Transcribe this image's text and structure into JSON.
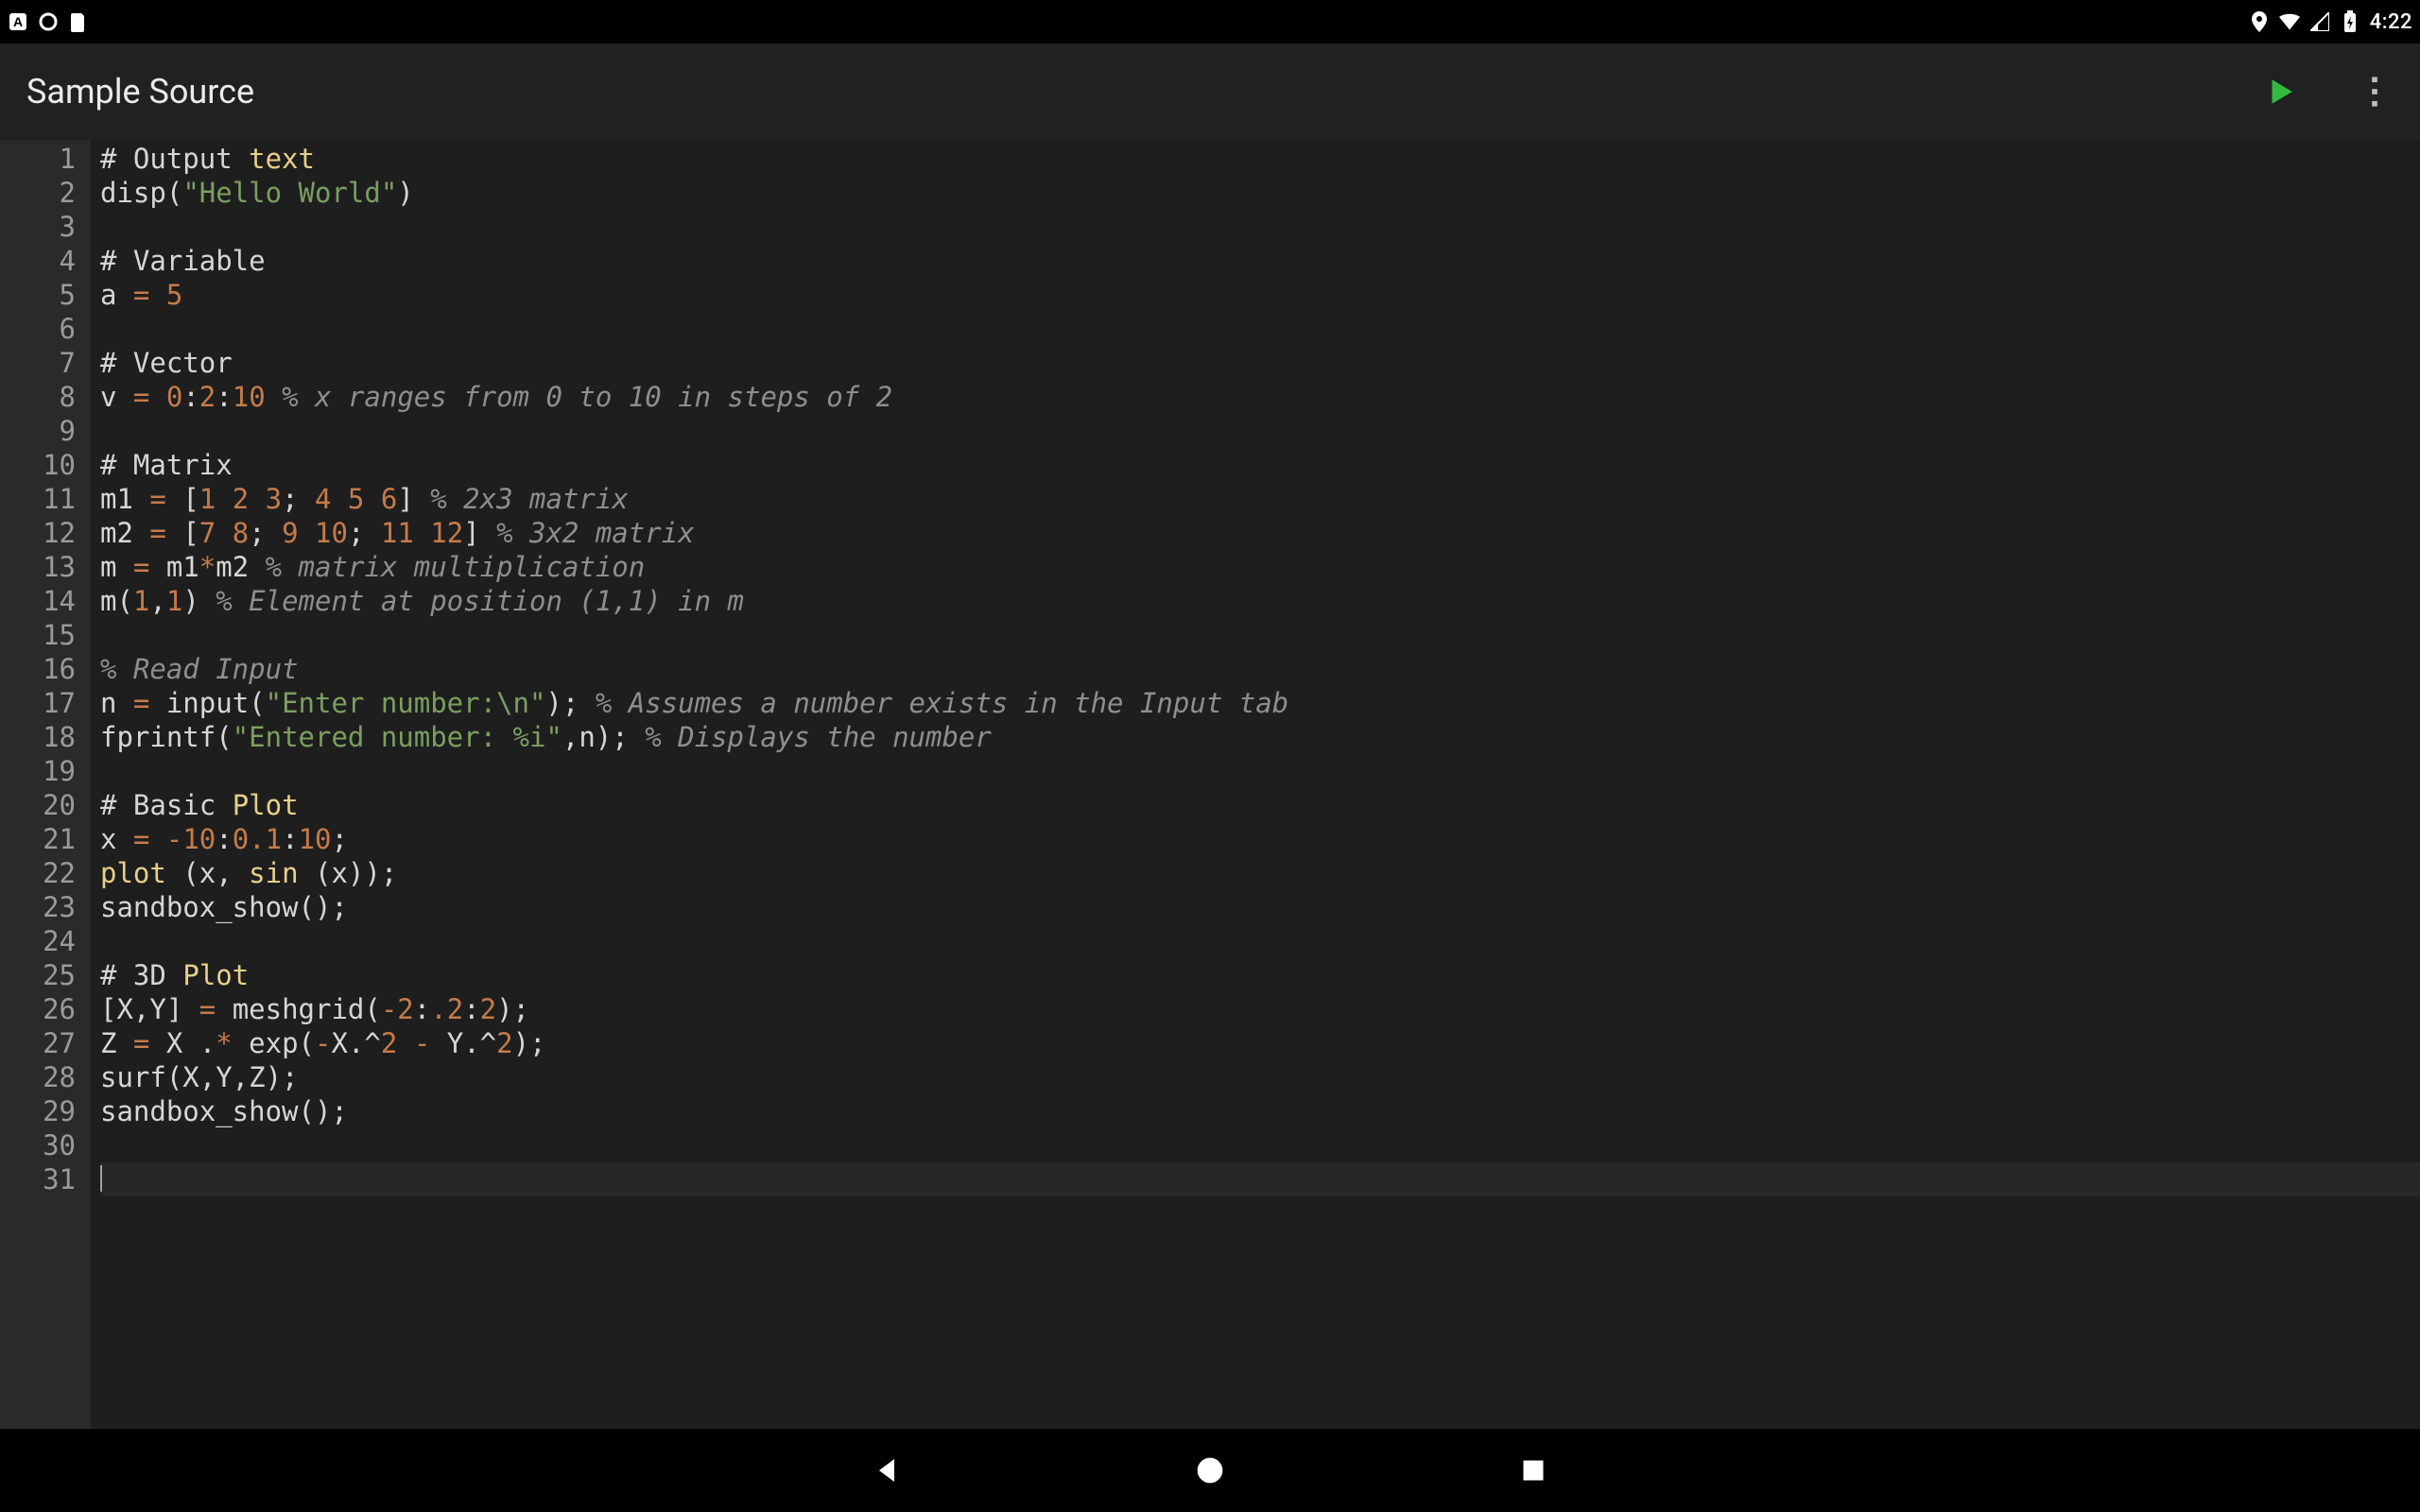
{
  "status": {
    "time": "4:22"
  },
  "appbar": {
    "title": "Sample Source"
  },
  "editor": {
    "current_line": 31,
    "lines": [
      {
        "n": 1,
        "tokens": [
          {
            "c": "tok-plain",
            "t": "# Output "
          },
          {
            "c": "tok-key",
            "t": "text"
          }
        ]
      },
      {
        "n": 2,
        "tokens": [
          {
            "c": "tok-id",
            "t": "disp("
          },
          {
            "c": "tok-str",
            "t": "\"Hello World\""
          },
          {
            "c": "tok-id",
            "t": ")"
          }
        ]
      },
      {
        "n": 3,
        "tokens": []
      },
      {
        "n": 4,
        "tokens": [
          {
            "c": "tok-plain",
            "t": "# Variable"
          }
        ]
      },
      {
        "n": 5,
        "tokens": [
          {
            "c": "tok-id",
            "t": "a "
          },
          {
            "c": "tok-eq",
            "t": "="
          },
          {
            "c": "tok-id",
            "t": " "
          },
          {
            "c": "tok-num",
            "t": "5"
          }
        ]
      },
      {
        "n": 6,
        "tokens": []
      },
      {
        "n": 7,
        "tokens": [
          {
            "c": "tok-plain",
            "t": "# Vector"
          }
        ]
      },
      {
        "n": 8,
        "tokens": [
          {
            "c": "tok-id",
            "t": "v "
          },
          {
            "c": "tok-eq",
            "t": "="
          },
          {
            "c": "tok-id",
            "t": " "
          },
          {
            "c": "tok-num",
            "t": "0"
          },
          {
            "c": "tok-id",
            "t": ":"
          },
          {
            "c": "tok-num",
            "t": "2"
          },
          {
            "c": "tok-id",
            "t": ":"
          },
          {
            "c": "tok-num",
            "t": "10"
          },
          {
            "c": "tok-id",
            "t": " "
          },
          {
            "c": "tok-cmt",
            "t": "% x ranges from 0 to 10 in steps of 2"
          }
        ]
      },
      {
        "n": 9,
        "tokens": []
      },
      {
        "n": 10,
        "tokens": [
          {
            "c": "tok-plain",
            "t": "# Matrix"
          }
        ]
      },
      {
        "n": 11,
        "tokens": [
          {
            "c": "tok-id",
            "t": "m1 "
          },
          {
            "c": "tok-eq",
            "t": "="
          },
          {
            "c": "tok-id",
            "t": " ["
          },
          {
            "c": "tok-num",
            "t": "1 2 3"
          },
          {
            "c": "tok-id",
            "t": "; "
          },
          {
            "c": "tok-num",
            "t": "4 5 6"
          },
          {
            "c": "tok-id",
            "t": "] "
          },
          {
            "c": "tok-cmt",
            "t": "% 2x3 matrix"
          }
        ]
      },
      {
        "n": 12,
        "tokens": [
          {
            "c": "tok-id",
            "t": "m2 "
          },
          {
            "c": "tok-eq",
            "t": "="
          },
          {
            "c": "tok-id",
            "t": " ["
          },
          {
            "c": "tok-num",
            "t": "7 8"
          },
          {
            "c": "tok-id",
            "t": "; "
          },
          {
            "c": "tok-num",
            "t": "9 10"
          },
          {
            "c": "tok-id",
            "t": "; "
          },
          {
            "c": "tok-num",
            "t": "11 12"
          },
          {
            "c": "tok-id",
            "t": "] "
          },
          {
            "c": "tok-cmt",
            "t": "% 3x2 matrix"
          }
        ]
      },
      {
        "n": 13,
        "tokens": [
          {
            "c": "tok-id",
            "t": "m "
          },
          {
            "c": "tok-eq",
            "t": "="
          },
          {
            "c": "tok-id",
            "t": " m1"
          },
          {
            "c": "tok-eq",
            "t": "*"
          },
          {
            "c": "tok-id",
            "t": "m2 "
          },
          {
            "c": "tok-cmt",
            "t": "% matrix multiplication"
          }
        ]
      },
      {
        "n": 14,
        "tokens": [
          {
            "c": "tok-id",
            "t": "m("
          },
          {
            "c": "tok-num",
            "t": "1"
          },
          {
            "c": "tok-id",
            "t": ","
          },
          {
            "c": "tok-num",
            "t": "1"
          },
          {
            "c": "tok-id",
            "t": ") "
          },
          {
            "c": "tok-cmt",
            "t": "% Element at position (1,1) in m"
          }
        ]
      },
      {
        "n": 15,
        "tokens": []
      },
      {
        "n": 16,
        "tokens": [
          {
            "c": "tok-cmt",
            "t": "% Read Input"
          }
        ]
      },
      {
        "n": 17,
        "tokens": [
          {
            "c": "tok-id",
            "t": "n "
          },
          {
            "c": "tok-eq",
            "t": "="
          },
          {
            "c": "tok-id",
            "t": " input("
          },
          {
            "c": "tok-str",
            "t": "\"Enter number:\\n\""
          },
          {
            "c": "tok-id",
            "t": "); "
          },
          {
            "c": "tok-cmt",
            "t": "% Assumes a number exists in the Input tab"
          }
        ]
      },
      {
        "n": 18,
        "tokens": [
          {
            "c": "tok-id",
            "t": "fprintf("
          },
          {
            "c": "tok-str",
            "t": "\"Entered number: %i\""
          },
          {
            "c": "tok-id",
            "t": ",n); "
          },
          {
            "c": "tok-cmt",
            "t": "% Displays the number"
          }
        ]
      },
      {
        "n": 19,
        "tokens": []
      },
      {
        "n": 20,
        "tokens": [
          {
            "c": "tok-plain",
            "t": "# Basic "
          },
          {
            "c": "tok-key",
            "t": "Plot"
          }
        ]
      },
      {
        "n": 21,
        "tokens": [
          {
            "c": "tok-id",
            "t": "x "
          },
          {
            "c": "tok-eq",
            "t": "="
          },
          {
            "c": "tok-id",
            "t": " "
          },
          {
            "c": "tok-num",
            "t": "-10"
          },
          {
            "c": "tok-id",
            "t": ":"
          },
          {
            "c": "tok-num",
            "t": "0.1"
          },
          {
            "c": "tok-id",
            "t": ":"
          },
          {
            "c": "tok-num",
            "t": "10"
          },
          {
            "c": "tok-id",
            "t": ";"
          }
        ]
      },
      {
        "n": 22,
        "tokens": [
          {
            "c": "tok-key",
            "t": "plot"
          },
          {
            "c": "tok-id",
            "t": " (x, "
          },
          {
            "c": "tok-key",
            "t": "sin"
          },
          {
            "c": "tok-id",
            "t": " (x));"
          }
        ]
      },
      {
        "n": 23,
        "tokens": [
          {
            "c": "tok-id",
            "t": "sandbox_show();"
          }
        ]
      },
      {
        "n": 24,
        "tokens": []
      },
      {
        "n": 25,
        "tokens": [
          {
            "c": "tok-plain",
            "t": "# 3D "
          },
          {
            "c": "tok-key",
            "t": "Plot"
          }
        ]
      },
      {
        "n": 26,
        "tokens": [
          {
            "c": "tok-id",
            "t": "[X,Y] "
          },
          {
            "c": "tok-eq",
            "t": "="
          },
          {
            "c": "tok-id",
            "t": " meshgrid("
          },
          {
            "c": "tok-num",
            "t": "-2"
          },
          {
            "c": "tok-id",
            "t": ":"
          },
          {
            "c": "tok-num",
            "t": ".2"
          },
          {
            "c": "tok-id",
            "t": ":"
          },
          {
            "c": "tok-num",
            "t": "2"
          },
          {
            "c": "tok-id",
            "t": ");"
          }
        ]
      },
      {
        "n": 27,
        "tokens": [
          {
            "c": "tok-id",
            "t": "Z "
          },
          {
            "c": "tok-eq",
            "t": "="
          },
          {
            "c": "tok-id",
            "t": " X ."
          },
          {
            "c": "tok-eq",
            "t": "*"
          },
          {
            "c": "tok-id",
            "t": " exp("
          },
          {
            "c": "tok-eq",
            "t": "-"
          },
          {
            "c": "tok-id",
            "t": "X.^"
          },
          {
            "c": "tok-num",
            "t": "2"
          },
          {
            "c": "tok-id",
            "t": " "
          },
          {
            "c": "tok-eq",
            "t": "-"
          },
          {
            "c": "tok-id",
            "t": " Y.^"
          },
          {
            "c": "tok-num",
            "t": "2"
          },
          {
            "c": "tok-id",
            "t": ");"
          }
        ]
      },
      {
        "n": 28,
        "tokens": [
          {
            "c": "tok-id",
            "t": "surf(X,Y,Z);"
          }
        ]
      },
      {
        "n": 29,
        "tokens": [
          {
            "c": "tok-id",
            "t": "sandbox_show();"
          }
        ]
      },
      {
        "n": 30,
        "tokens": []
      },
      {
        "n": 31,
        "tokens": []
      }
    ]
  }
}
